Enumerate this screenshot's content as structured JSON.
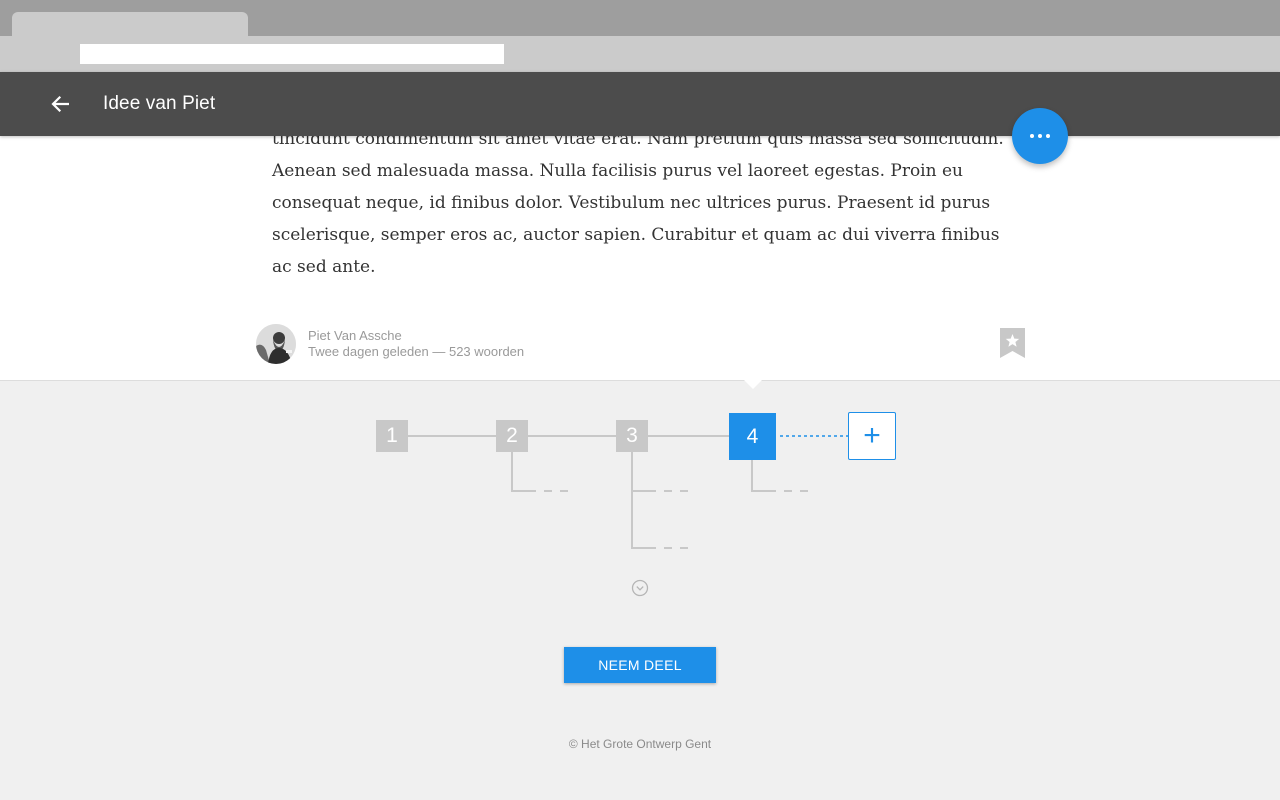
{
  "browser": {
    "url": ""
  },
  "appbar": {
    "title": "Idee van Piet"
  },
  "article": {
    "text": "tincidunt condimentum sit amet vitae erat. Nam pretium quis massa sed sollicitudin. Aenean sed malesuada massa. Nulla facilisis purus vel laoreet egestas. Proin eu consequat neque, id finibus dolor. Vestibulum nec ultrices purus. Praesent id purus scelerisque, semper eros ac, auctor sapien. Curabitur et quam ac dui viverra finibus ac sed ante.",
    "author": "Piet Van Assche",
    "time": "Twee dagen geleden",
    "separator": "—",
    "words": "523 woorden"
  },
  "tree": {
    "nodes": [
      {
        "label": "1",
        "active": false
      },
      {
        "label": "2",
        "active": false
      },
      {
        "label": "3",
        "active": false
      },
      {
        "label": "4",
        "active": true
      }
    ],
    "add_label": "+"
  },
  "cta": {
    "label": "NEEM DEEL"
  },
  "footer": {
    "text": "© Het Grote Ontwerp Gent"
  },
  "colors": {
    "accent": "#1e8fe8",
    "appbar": "#4c4c4c",
    "node_inactive": "#c8c8c8",
    "background": "#f0f0f0"
  },
  "icons": {
    "back": "arrow-left-icon",
    "fab": "more-horizontal-icon",
    "bookmark": "bookmark-star-icon",
    "expand": "chevron-down-circle-icon"
  }
}
